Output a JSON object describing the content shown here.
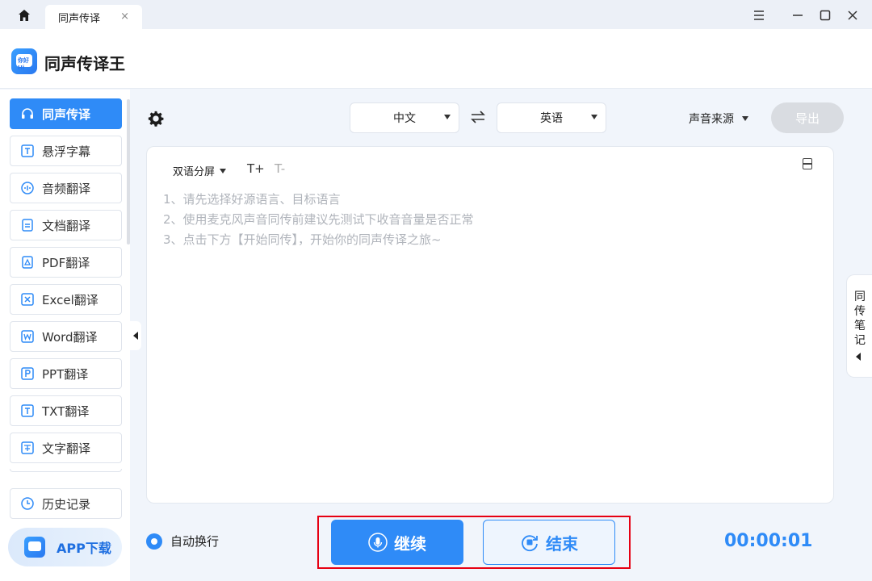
{
  "titlebar": {
    "tab_label": "同声传译",
    "tab_close": "×"
  },
  "header": {
    "app_name": "同声传译王",
    "logo_text": "你好 Hi"
  },
  "sidebar": {
    "items": [
      {
        "label": "同声传译",
        "icon": "headset-icon",
        "active": true
      },
      {
        "label": "悬浮字幕",
        "icon": "subtitle-icon"
      },
      {
        "label": "音频翻译",
        "icon": "audio-wave-icon"
      },
      {
        "label": "文档翻译",
        "icon": "document-icon"
      },
      {
        "label": "PDF翻译",
        "icon": "pdf-icon"
      },
      {
        "label": "Excel翻译",
        "icon": "excel-icon"
      },
      {
        "label": "Word翻译",
        "icon": "word-icon"
      },
      {
        "label": "PPT翻译",
        "icon": "ppt-icon"
      },
      {
        "label": "TXT翻译",
        "icon": "txt-icon"
      },
      {
        "label": "文字翻译",
        "icon": "text-translate-icon"
      }
    ],
    "history_label": "历史记录",
    "app_download_label": "APP下载"
  },
  "toolbar": {
    "source_language": "中文",
    "target_language": "英语",
    "sound_source_label": "声音来源",
    "export_label": "导出"
  },
  "panel": {
    "split_mode_label": "双语分屏",
    "font_increase": "T+",
    "font_decrease": "T-",
    "hints": [
      "1、请先选择好源语言、目标语言",
      "2、使用麦克风声音同传前建议先测试下收音音量是否正常",
      "3、点击下方【开始同传】，开始你的同声传译之旅~"
    ]
  },
  "notes_tab": {
    "label": "同传笔记"
  },
  "bottom": {
    "auto_wrap_label": "自动换行",
    "continue_label": "继续",
    "end_label": "结束",
    "timer": "00:00:01"
  },
  "colors": {
    "accent": "#2f8bf7",
    "highlight": "#e60012"
  }
}
